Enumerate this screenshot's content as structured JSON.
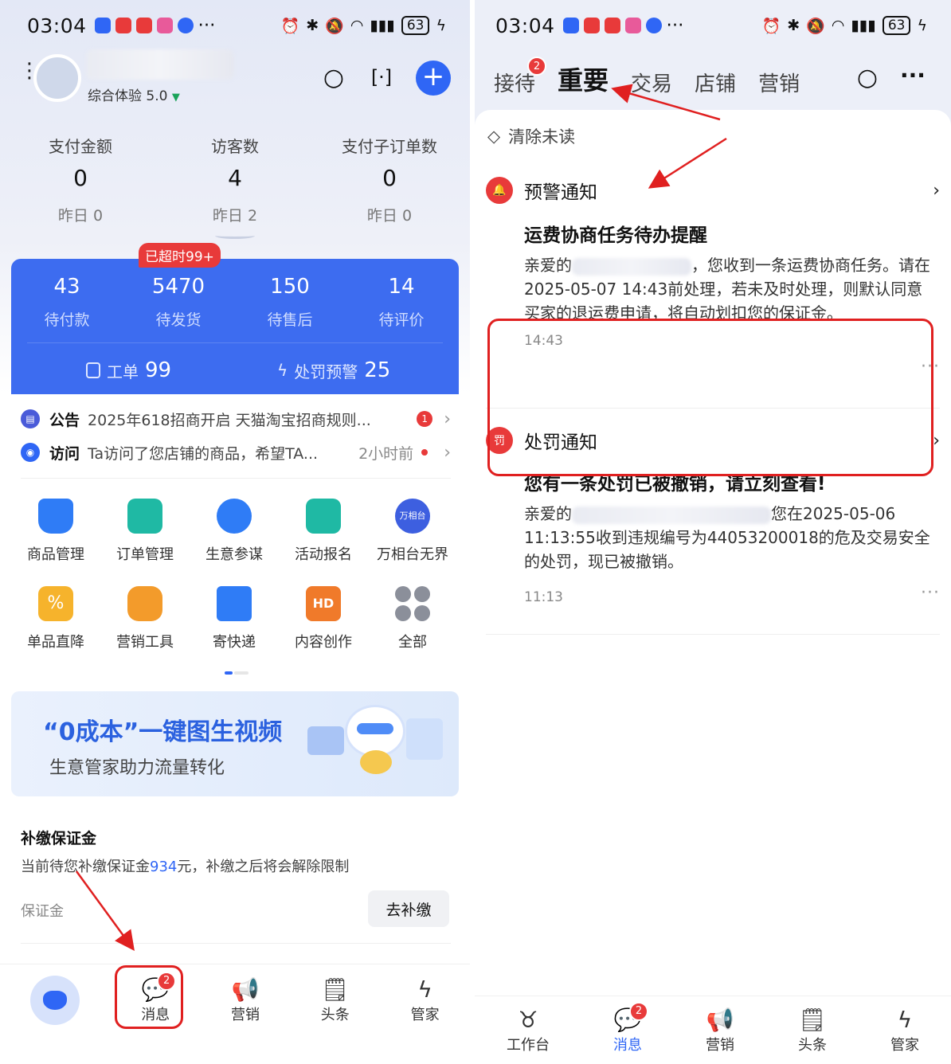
{
  "status": {
    "time": "03:04",
    "battery": "63",
    "more": "···"
  },
  "left": {
    "header": {
      "rating_label": "综合体验 5.0",
      "rating_arrow": "▼"
    },
    "stats": [
      {
        "label": "支付金额",
        "value": "0",
        "yesterday": "昨日 0"
      },
      {
        "label": "访客数",
        "value": "4",
        "yesterday": "昨日 2"
      },
      {
        "label": "支付子订单数",
        "value": "0",
        "yesterday": "昨日 0"
      }
    ],
    "order_stats": [
      {
        "value": "43",
        "label": "待付款"
      },
      {
        "value": "5470",
        "label": "待发货"
      },
      {
        "value": "150",
        "label": "待售后"
      },
      {
        "value": "14",
        "label": "待评价"
      }
    ],
    "overtime_badge": "已超时99+",
    "workorder": {
      "label": "工单",
      "value": "99"
    },
    "penalty_warning": {
      "label": "处罚预警",
      "value": "25"
    },
    "notices": [
      {
        "key": "公告",
        "text": "2025年618招商开启 天猫淘宝招商规则...",
        "badge": "1"
      },
      {
        "key": "访问",
        "text": "Ta访问了您店铺的商品，希望TA...",
        "time": "2小时前"
      }
    ],
    "tools": [
      {
        "label": "商品管理",
        "color": "#2f7cf6"
      },
      {
        "label": "订单管理",
        "color": "#1fb9a4"
      },
      {
        "label": "生意参谋",
        "color": "#2f7cf6"
      },
      {
        "label": "活动报名",
        "color": "#1fb9a4"
      },
      {
        "label": "万相台无界",
        "color": "#3d5fe0",
        "icon_text": "万相台"
      },
      {
        "label": "单品直降",
        "color": "#f6b32c"
      },
      {
        "label": "营销工具",
        "color": "#f39b2b"
      },
      {
        "label": "寄快递",
        "color": "#2f7cf6"
      },
      {
        "label": "内容创作",
        "color": "#f07a2a",
        "icon_text": "HD"
      },
      {
        "label": "全部",
        "color": "#8b8f9a"
      }
    ],
    "banner": {
      "title": "“0成本”一键图生视频",
      "subtitle": "生意管家助力流量转化"
    },
    "deposit": {
      "title": "补缴保证金",
      "desc_prefix": "当前待您补缴保证金",
      "amount": "934",
      "desc_suffix": "元，补缴之后将会解除限制",
      "label": "保证金",
      "button": "去补缴"
    },
    "nav": [
      {
        "label": "",
        "icon": "cow-icon"
      },
      {
        "label": "消息",
        "badge": "2"
      },
      {
        "label": "营销"
      },
      {
        "label": "头条"
      },
      {
        "label": "管家"
      }
    ]
  },
  "right": {
    "tabs": [
      {
        "label": "接待",
        "badge": "2"
      },
      {
        "label": "重要"
      },
      {
        "label": "交易"
      },
      {
        "label": "店铺"
      },
      {
        "label": "营销"
      }
    ],
    "clear_unread": "清除未读",
    "messages": [
      {
        "category": "预警通知",
        "icon_text": "",
        "title": "运费协商任务待办提醒",
        "body_a": "亲爱的",
        "body_b": "，您收到一条运费协商任务。请在2025-05-07 14:43前处理，若未及时处理，则默认同意买家的退运费申请，将自动划扣您的保证金。",
        "time": "14:43"
      },
      {
        "category": "处罚通知",
        "icon_text": "罚",
        "title": "您有一条处罚已被撤销，请立刻查看!",
        "body_a": "亲爱的",
        "body_b": "您在2025-05-06 11:13:55收到违规编号为44053200018的危及交易安全 的处罚，现已被撤销。",
        "time": "11:13"
      }
    ],
    "nav": [
      {
        "label": "工作台"
      },
      {
        "label": "消息",
        "badge": "2"
      },
      {
        "label": "营销"
      },
      {
        "label": "头条"
      },
      {
        "label": "管家"
      }
    ]
  }
}
